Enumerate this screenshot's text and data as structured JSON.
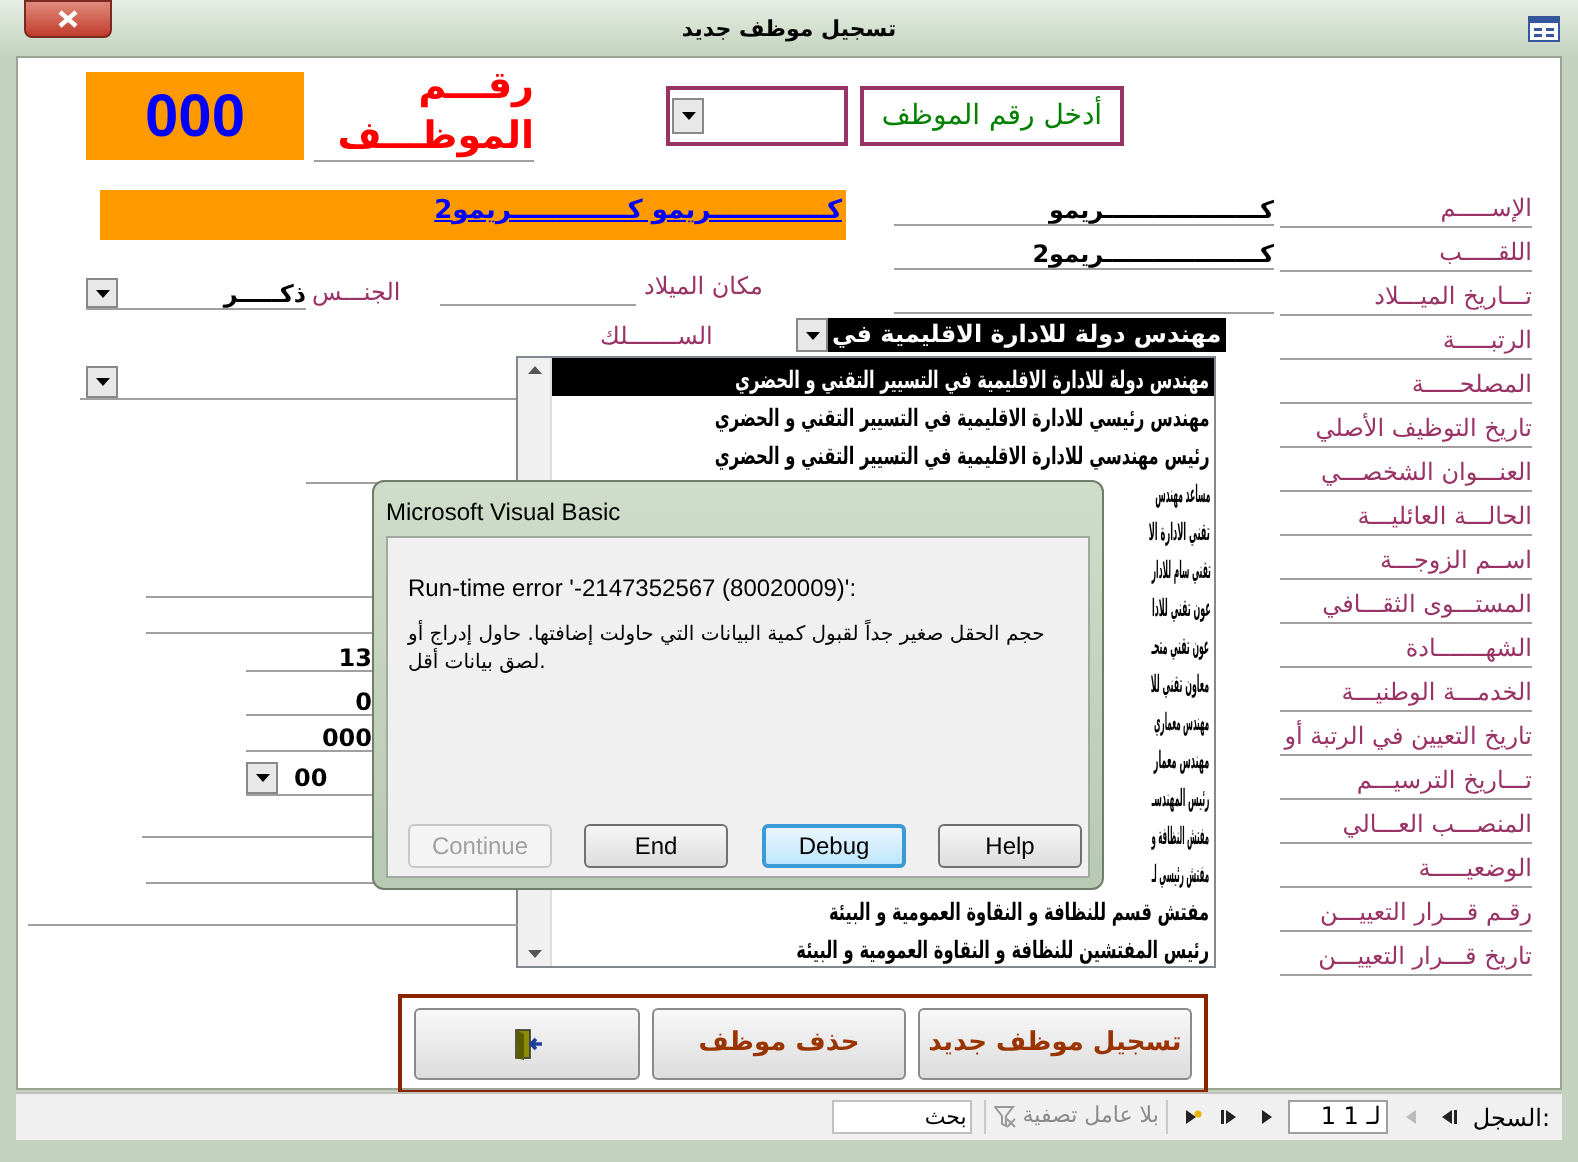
{
  "window": {
    "title": "تسجيل موظف جديد"
  },
  "employee_number": {
    "label": [
      "رقـــم",
      "الموظـــف"
    ],
    "value": "000"
  },
  "lookup": {
    "label": "أدخل رقم الموظف"
  },
  "full_name": "كـــــــــــــريمو كـــــــــــــريمو2",
  "fields": [
    {
      "label": "الإســـــم",
      "value": "كـــــــــــــــــــريمو"
    },
    {
      "label": "اللقـــــب",
      "value": "كـــــــــــــــــــريمو2"
    },
    {
      "label": "تـــاريخ الميـــلاد"
    },
    {
      "label": "الرتبـــــة"
    },
    {
      "label": "المصلحـــــة"
    },
    {
      "label": "تاريخ التوظيف الأصلي"
    },
    {
      "label": "العنـــوان الشخصـــي"
    },
    {
      "label": "الحالـــة العائليـــة"
    },
    {
      "label": "اســم الزوجـــة"
    },
    {
      "label": "المستـــوى الثقـــافي"
    },
    {
      "label": "الشهـــــــادة"
    },
    {
      "label": "الخدمـــة الوطنيـــة"
    },
    {
      "label": "تاريخ التعيين في الرتبة أو"
    },
    {
      "label": "تـــاريخ الترسيـــم"
    },
    {
      "label": "المنصـــب العـــالي"
    },
    {
      "label": "الوضعيـــــة"
    },
    {
      "label": "رقـم قـــرار التعييـــن"
    },
    {
      "label": "تاريخ قـــرار التعييـــن"
    }
  ],
  "birthplace": {
    "label": "مكان الميلاد"
  },
  "gender": {
    "label": "الجنـــس",
    "value": "ذكـــــر"
  },
  "corps": {
    "label": "الســـــــلك"
  },
  "grade_combo": {
    "value": "مهندس دولة للادارة الاقليمية في"
  },
  "grade_list": [
    {
      "text": "مهندس دولة للادارة الاقليمية في التسيير التقني و الحضري",
      "selected": true
    },
    {
      "text": "مهندس رئيسي للادارة الاقليمية في التسيير التقني و الحضري",
      "selected": false
    },
    {
      "text": "رئيس مهندسي للادارة الاقليمية في التسيير التقني و الحضري",
      "selected": false
    },
    {
      "text": "مساعد مهندس",
      "selected": false
    },
    {
      "text": "تقني الادارة الا",
      "selected": false
    },
    {
      "text": "تقني سام للادار",
      "selected": false
    },
    {
      "text": "عون تقني للادا",
      "selected": false
    },
    {
      "text": "عون تقني متحـ",
      "selected": false
    },
    {
      "text": "معاون تقني للا",
      "selected": false
    },
    {
      "text": "مهندس معماري",
      "selected": false
    },
    {
      "text": "مهندس معمار",
      "selected": false
    },
    {
      "text": "رئيس المهندسـ",
      "selected": false
    },
    {
      "text": "مفتش النظافة و",
      "selected": false
    },
    {
      "text": "مفتش رئيسي لـ",
      "selected": false
    },
    {
      "text": "مفتش قسم للنظافة و النقاوة العمومية و البيئة",
      "selected": false
    },
    {
      "text": "رئيس المفتشين للنظافة و النقاوة العمومية و البيئة",
      "selected": false
    }
  ],
  "left_values": [
    "13",
    "0",
    "000"
  ],
  "left_combo": {
    "value": "00"
  },
  "dialog": {
    "title": "Microsoft Visual Basic",
    "error": "Run-time error '-2147352567 (80020009)':",
    "message": "حجم الحقل صغير جداً لقبول كمية البيانات التي حاولت إضافتها. حاول إدراج أو لصق بيانات أقل.",
    "buttons": [
      {
        "label": "Help",
        "disabled": false,
        "default": false
      },
      {
        "label": "Debug",
        "disabled": false,
        "default": true
      },
      {
        "label": "End",
        "disabled": false,
        "default": false
      },
      {
        "label": "Continue",
        "disabled": true,
        "default": false
      }
    ]
  },
  "actions": [
    {
      "kind": "text",
      "label": "تسجيل موظف جديد"
    },
    {
      "kind": "text",
      "label": "حذف موظف"
    },
    {
      "kind": "exit"
    }
  ],
  "status_bar": {
    "record_label": "السجل:",
    "record": "1 لـ 1",
    "filter": "بلا عامل تصفية",
    "search_placeholder": "بحث"
  }
}
